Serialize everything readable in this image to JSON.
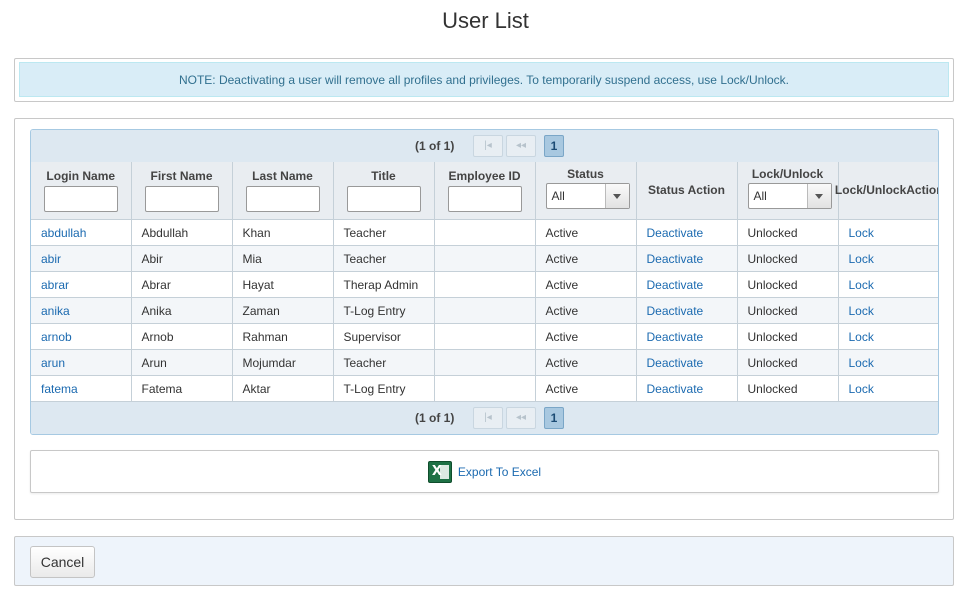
{
  "page": {
    "title": "User List"
  },
  "note": {
    "text": "NOTE: Deactivating a user will remove all profiles and privileges. To temporarily suspend access, use Lock/Unlock."
  },
  "pager": {
    "info": "(1 of 1)",
    "first_icon": "first-page-icon",
    "prev_icon": "prev-page-icon",
    "current_page": "1"
  },
  "table": {
    "columns": {
      "login_name": "Login Name",
      "first_name": "First Name",
      "last_name": "Last Name",
      "title": "Title",
      "employee_id": "Employee ID",
      "status": "Status",
      "status_action": "Status Action",
      "lock_unlock": "Lock/Unlock",
      "lock_unlock_action_1": "Lock/Unlock",
      "lock_unlock_action_2": "Action"
    },
    "filters": {
      "status_selected": "All",
      "lock_unlock_selected": "All"
    },
    "rows": [
      {
        "login": "abdullah",
        "first": "Abdullah",
        "last": "Khan",
        "title": "Teacher",
        "employee_id": "",
        "status": "Active",
        "status_action": "Deactivate",
        "lock_state": "Unlocked",
        "lock_action": "Lock"
      },
      {
        "login": "abir",
        "first": "Abir",
        "last": "Mia",
        "title": "Teacher",
        "employee_id": "",
        "status": "Active",
        "status_action": "Deactivate",
        "lock_state": "Unlocked",
        "lock_action": "Lock"
      },
      {
        "login": "abrar",
        "first": "Abrar",
        "last": "Hayat",
        "title": "Therap Admin",
        "employee_id": "",
        "status": "Active",
        "status_action": "Deactivate",
        "lock_state": "Unlocked",
        "lock_action": "Lock"
      },
      {
        "login": "anika",
        "first": "Anika",
        "last": "Zaman",
        "title": "T-Log Entry",
        "employee_id": "",
        "status": "Active",
        "status_action": "Deactivate",
        "lock_state": "Unlocked",
        "lock_action": "Lock"
      },
      {
        "login": "arnob",
        "first": "Arnob",
        "last": "Rahman",
        "title": "Supervisor",
        "employee_id": "",
        "status": "Active",
        "status_action": "Deactivate",
        "lock_state": "Unlocked",
        "lock_action": "Lock"
      },
      {
        "login": "arun",
        "first": "Arun",
        "last": "Mojumdar",
        "title": "Teacher",
        "employee_id": "",
        "status": "Active",
        "status_action": "Deactivate",
        "lock_state": "Unlocked",
        "lock_action": "Lock"
      },
      {
        "login": "fatema",
        "first": "Fatema",
        "last": "Aktar",
        "title": "T-Log Entry",
        "employee_id": "",
        "status": "Active",
        "status_action": "Deactivate",
        "lock_state": "Unlocked",
        "lock_action": "Lock"
      }
    ]
  },
  "export": {
    "label": "Export To Excel",
    "icon": "excel-icon"
  },
  "footer": {
    "cancel_label": "Cancel"
  },
  "colors": {
    "note_bg": "#d9edf7",
    "note_text": "#31708f",
    "link": "#1b6ab0",
    "pager_bg": "#dde8f1",
    "footer_bg": "#eef4fb"
  }
}
